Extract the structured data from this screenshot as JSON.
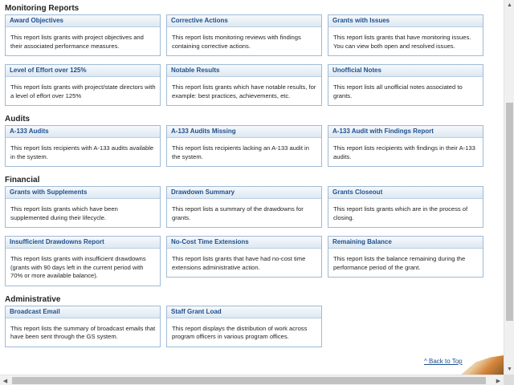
{
  "sections": [
    {
      "title": "Monitoring Reports",
      "rows": [
        [
          {
            "title": "Award Objectives",
            "desc": "This report lists grants with project objectives and their associated performance measures."
          },
          {
            "title": "Corrective Actions",
            "desc": "This report lists monitoring reviews with findings containing corrective actions."
          },
          {
            "title": "Grants with Issues",
            "desc": "This report lists grants that have monitoring issues. You can view both open and resolved issues."
          }
        ],
        [
          {
            "title": "Level of Effort over 125%",
            "desc": "This report lists grants with project/state directors with a level of effort over 125%"
          },
          {
            "title": "Notable Results",
            "desc": "This report lists grants which have notable results, for example: best practices, achievements, etc."
          },
          {
            "title": "Unofficial Notes",
            "desc": "This report lists all unofficial notes associated to grants."
          }
        ]
      ]
    },
    {
      "title": "Audits",
      "rows": [
        [
          {
            "title": "A-133 Audits",
            "desc": "This report lists recipients with A-133 audits available in the system."
          },
          {
            "title": "A-133 Audits Missing",
            "desc": "This report lists recipients lacking an A-133 audit in the system."
          },
          {
            "title": "A-133 Audit with Findings Report",
            "desc": "This report lists recipients with findings in their A-133 audits."
          }
        ]
      ]
    },
    {
      "title": "Financial",
      "rows": [
        [
          {
            "title": "Grants with Supplements",
            "desc": "This report lists grants which have been supplemented during their lifecycle."
          },
          {
            "title": "Drawdown Summary",
            "desc": "This report lists a summary of the drawdowns for grants."
          },
          {
            "title": "Grants Closeout",
            "desc": "This report lists grants which are in the process of closing."
          }
        ],
        [
          {
            "title": "Insufficient Drawdowns Report",
            "desc": "This report lists grants with insufficient drawdowns (grants with 90 days left in the current period with 70% or more available balance)."
          },
          {
            "title": "No-Cost Time Extensions",
            "desc": "This report lists grants that have had no-cost time extensions administrative action."
          },
          {
            "title": "Remaining Balance",
            "desc": "This report lists the balance remaining during the performance period of the grant."
          }
        ]
      ]
    },
    {
      "title": "Administrative",
      "rows": [
        [
          {
            "title": "Broadcast Email",
            "desc": "This report lists the summary of broadcast emails that have been sent through the GS system."
          },
          {
            "title": "Staff Grant Load",
            "desc": "This report displays the distribution of work across program officers in various program offices."
          }
        ]
      ]
    }
  ],
  "back_to_top": "^ Back to Top",
  "icons": {
    "scroll_up": "triangle-up-icon",
    "scroll_down": "triangle-down-icon",
    "scroll_left": "triangle-left-icon",
    "scroll_right": "triangle-right-icon"
  },
  "colors": {
    "card_title": "#1d4f8c",
    "card_border": "#9fbad4",
    "link": "#1d4f8c"
  }
}
